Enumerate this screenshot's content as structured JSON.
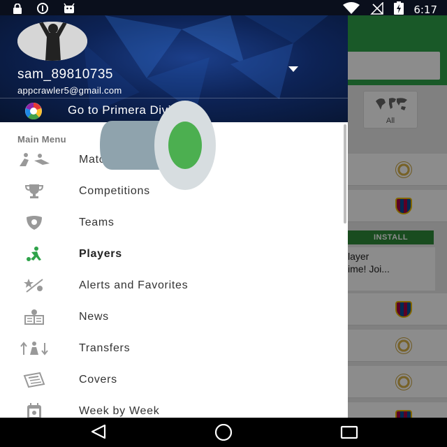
{
  "status_bar": {
    "time": "6:17",
    "left_icons": [
      "lock-icon",
      "sync-icon",
      "android-icon"
    ],
    "right_icons": [
      "wifi-icon",
      "no-signal-icon",
      "battery-charging-icon"
    ]
  },
  "drawer": {
    "username": "sam_89810735",
    "email": "appcrawler5@gmail.com",
    "league_label": "Go to Primera División",
    "section_title": "Main Menu",
    "items": [
      {
        "label": "Matches",
        "icon": "players-icon",
        "active": false
      },
      {
        "label": "Competitions",
        "icon": "trophy-icon",
        "active": false
      },
      {
        "label": "Teams",
        "icon": "shield-icon",
        "active": false
      },
      {
        "label": "Players",
        "icon": "player-kick-icon",
        "active": true
      },
      {
        "label": "Alerts and Favorites",
        "icon": "star-alert-icon",
        "active": false
      },
      {
        "label": "News",
        "icon": "news-icon",
        "active": false
      },
      {
        "label": "Transfers",
        "icon": "transfers-icon",
        "active": false
      },
      {
        "label": "Covers",
        "icon": "covers-icon",
        "active": false
      },
      {
        "label": "Week by Week",
        "icon": "calendar-icon",
        "active": false
      }
    ]
  },
  "background": {
    "filter_label": "All",
    "install_label": "INSTALL",
    "ad_line1": "layer",
    "ad_line2": "ime! Joi..."
  },
  "colors": {
    "accent_green": "#2fa34a",
    "header_blue": "#0d2356",
    "overlay_green": "#4caf50"
  }
}
